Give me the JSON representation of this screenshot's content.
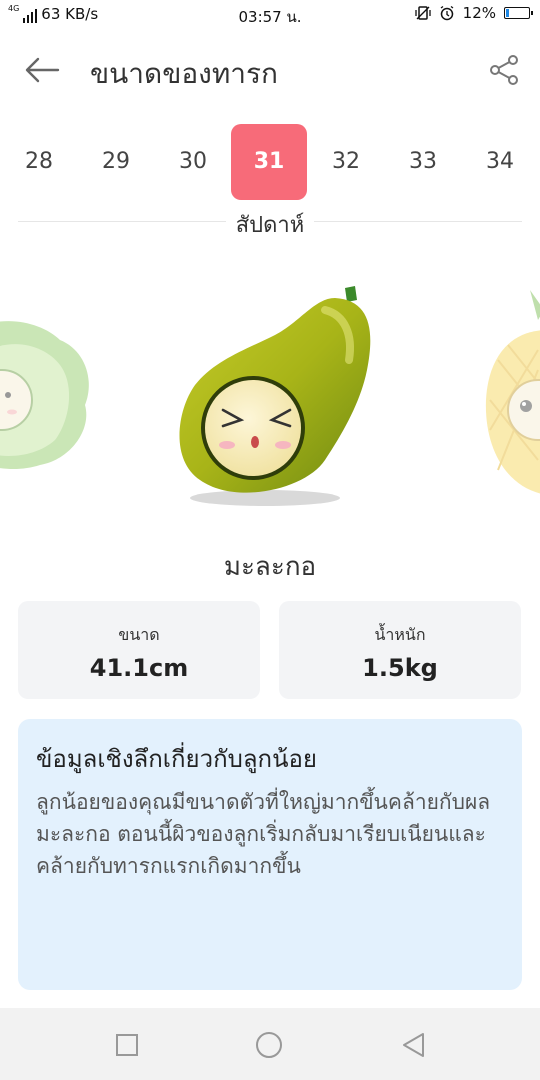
{
  "status_bar": {
    "network_type": "4G",
    "data_speed": "63 KB/s",
    "time": "03:57 น.",
    "battery_percent": "12%",
    "battery_level": 0.12,
    "icons": [
      "signal-icon",
      "vibrate-icon",
      "alarm-icon",
      "battery-icon"
    ]
  },
  "header": {
    "title": "ขนาดของทารก",
    "back_icon": "arrow-left-icon",
    "share_icon": "share-icon"
  },
  "weeks": {
    "items": [
      "28",
      "29",
      "30",
      "31",
      "32",
      "33",
      "34"
    ],
    "selected": "31",
    "unit_label": "สัปดาห์"
  },
  "fruit": {
    "name": "มะละกอ",
    "neighbors": [
      "lettuce-icon",
      "pineapple-icon"
    ]
  },
  "stats": {
    "size_label": "ขนาด",
    "size_value": "41.1cm",
    "weight_label": "น้ำหนัก",
    "weight_value": "1.5kg"
  },
  "insight": {
    "title": "ข้อมูลเชิงลึกเกี่ยวกับลูกน้อย",
    "body": "ลูกน้อยของคุณมีขนาดตัวที่ใหญ่มากขึ้นคล้ายกับผลมะละกอ ตอนนี้ผิวของลูกเริ่มกลับมาเรียบเนียนและคล้ายกับทารกแรกเกิดมากขึ้น"
  },
  "colors": {
    "accent": "#f76b79",
    "card_bg": "#f3f4f6",
    "insight_bg": "#e3f1fd",
    "papaya_green": "#a8b418"
  }
}
